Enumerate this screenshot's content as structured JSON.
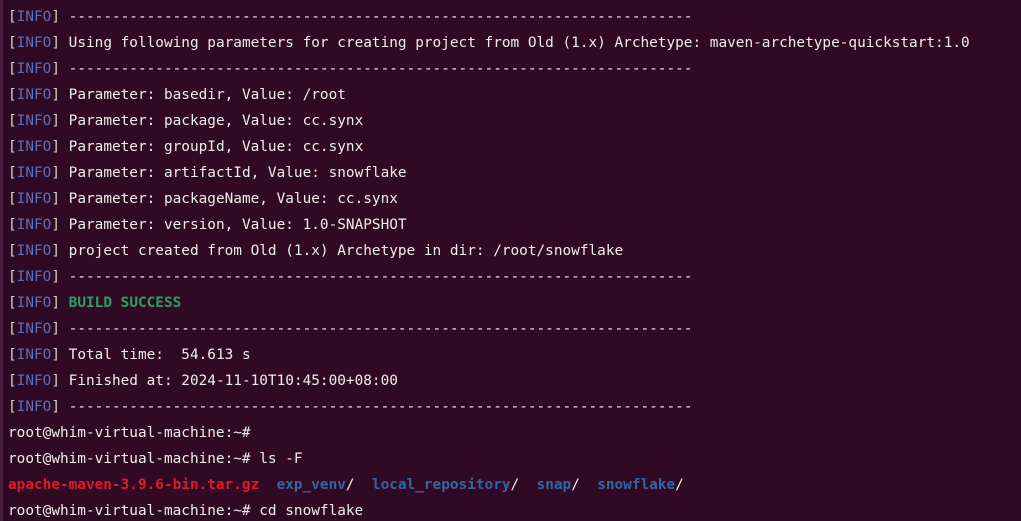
{
  "terminal": {
    "log_lines": [
      {
        "tag": "INFO",
        "text": " ------------------------------------------------------------------------"
      },
      {
        "tag": "INFO",
        "text": " Using following parameters for creating project from Old (1.x) Archetype: maven-archetype-quickstart:1.0"
      },
      {
        "tag": "INFO",
        "text": " ------------------------------------------------------------------------"
      },
      {
        "tag": "INFO",
        "text": " Parameter: basedir, Value: /root"
      },
      {
        "tag": "INFO",
        "text": " Parameter: package, Value: cc.synx"
      },
      {
        "tag": "INFO",
        "text": " Parameter: groupId, Value: cc.synx"
      },
      {
        "tag": "INFO",
        "text": " Parameter: artifactId, Value: snowflake"
      },
      {
        "tag": "INFO",
        "text": " Parameter: packageName, Value: cc.synx"
      },
      {
        "tag": "INFO",
        "text": " Parameter: version, Value: 1.0-SNAPSHOT"
      },
      {
        "tag": "INFO",
        "text": " project created from Old (1.x) Archetype in dir: /root/snowflake"
      },
      {
        "tag": "INFO",
        "text": " ------------------------------------------------------------------------"
      }
    ],
    "build_line": {
      "tag": "INFO",
      "prefix": " ",
      "success": "BUILD SUCCESS"
    },
    "log_lines_2": [
      {
        "tag": "INFO",
        "text": " ------------------------------------------------------------------------"
      },
      {
        "tag": "INFO",
        "text": " Total time:  54.613 s"
      },
      {
        "tag": "INFO",
        "text": " Finished at: 2024-11-10T10:45:00+08:00"
      },
      {
        "tag": "INFO",
        "text": " ------------------------------------------------------------------------"
      }
    ],
    "prompt1": "root@whim-virtual-machine:~#",
    "prompt2": "root@whim-virtual-machine:~# ls -F",
    "ls_output": [
      {
        "name": "apache-maven-3.9.6-bin.tar.gz",
        "type": "archive",
        "suffix": ""
      },
      {
        "name": "exp_venv",
        "type": "dir",
        "suffix": "/"
      },
      {
        "name": "local_repository",
        "type": "dir",
        "suffix": "/"
      },
      {
        "name": "snap",
        "type": "dir",
        "suffix": "/"
      },
      {
        "name": "snowflake",
        "type": "dir",
        "suffix": "/"
      }
    ],
    "prompt3": "root@whim-virtual-machine:~# cd snowflake",
    "colors": {
      "background": "#300a24",
      "info": "#5a6fb8",
      "success": "#26a269",
      "archive": "#e01b24",
      "directory": "#3465a4",
      "text": "#eeeeec"
    }
  }
}
